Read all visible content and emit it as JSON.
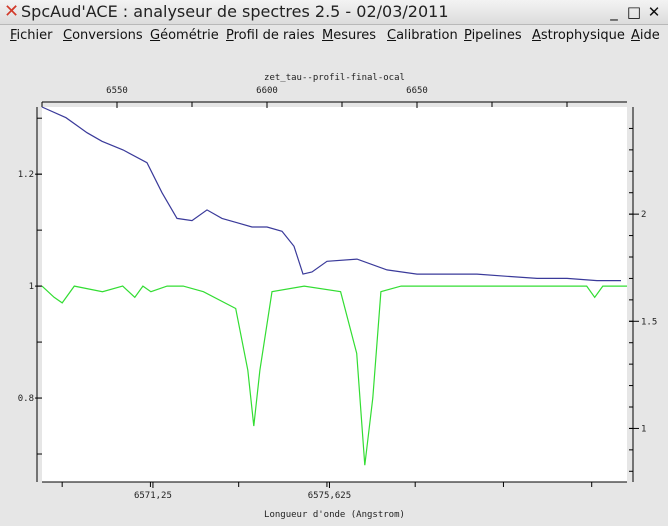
{
  "window": {
    "title": "SpcAud'ACE : analyseur de spectres 2.5 - 02/03/2011",
    "close_glyph": "✕",
    "minimize_glyph": "_",
    "maximize_glyph": "□",
    "close_btn_glyph": "✕"
  },
  "menubar": {
    "items": [
      {
        "first": "F",
        "rest": "ichier"
      },
      {
        "first": "C",
        "rest": "onversions"
      },
      {
        "first": "G",
        "rest": "éométrie"
      },
      {
        "first": "P",
        "rest": "rofil de raies"
      },
      {
        "first": "M",
        "rest": "esures"
      },
      {
        "first": "C",
        "rest": "alibration"
      },
      {
        "first": "P",
        "rest": "ipelines"
      },
      {
        "first": "A",
        "rest": "strophysique"
      },
      {
        "first": "A",
        "rest": "ide"
      }
    ]
  },
  "chart_data": {
    "type": "line",
    "title": "zet_tau--profil-final-ocal",
    "xlabel": "Longueur d'onde (Angstrom)",
    "top_axis": {
      "ticks": [
        6550,
        6600,
        6650
      ],
      "labels": [
        "6550",
        "6600",
        "6650"
      ],
      "range": [
        6525,
        6720
      ]
    },
    "bottom_axis": {
      "ticks": [
        6571.25,
        6575.625
      ],
      "labels": [
        "6571,25",
        "6575,625"
      ],
      "range": [
        6568.5,
        6583
      ]
    },
    "left_axis": {
      "ticks": [
        1.2,
        1,
        0.8
      ],
      "labels": [
        "1.2",
        "1",
        "0.8"
      ],
      "range": [
        0.65,
        1.32
      ]
    },
    "right_axis": {
      "ticks": [
        2,
        1.5,
        1
      ],
      "labels": [
        "2",
        "1.5",
        "1"
      ],
      "range": [
        0.75,
        2.5
      ]
    },
    "series": [
      {
        "color": "#3a3a9a",
        "axes": "top-right",
        "x": [
          6525,
          6533,
          6540,
          6545,
          6552,
          6560,
          6565,
          6570,
          6575,
          6580,
          6585,
          6590,
          6595,
          6600,
          6605,
          6609,
          6612,
          6615,
          6620,
          6630,
          6640,
          6650,
          6660,
          6670,
          6680,
          6690,
          6700,
          6710,
          6718
        ],
        "y": [
          2.55,
          2.45,
          2.38,
          2.34,
          2.3,
          2.24,
          2.1,
          1.98,
          1.97,
          2.02,
          1.98,
          1.96,
          1.94,
          1.94,
          1.92,
          1.85,
          1.72,
          1.73,
          1.78,
          1.79,
          1.74,
          1.72,
          1.72,
          1.72,
          1.71,
          1.7,
          1.7,
          1.69,
          1.69
        ]
      },
      {
        "color": "#33dd33",
        "axes": "bottom-left",
        "x": [
          6568.5,
          6568.8,
          6569.0,
          6569.3,
          6570.0,
          6570.5,
          6570.8,
          6571.0,
          6571.2,
          6571.6,
          6572.0,
          6572.5,
          6573.3,
          6573.6,
          6573.75,
          6573.9,
          6574.2,
          6575.0,
          6575.9,
          6576.3,
          6576.5,
          6576.7,
          6576.9,
          6577.4,
          6578.0,
          6580.0,
          6582.0,
          6582.2,
          6582.4,
          6583.0
        ],
        "y": [
          1.0,
          0.98,
          0.97,
          1.0,
          0.99,
          1.0,
          0.98,
          1.0,
          0.99,
          1.0,
          1.0,
          0.99,
          0.96,
          0.85,
          0.75,
          0.85,
          0.99,
          1.0,
          0.99,
          0.88,
          0.68,
          0.8,
          0.99,
          1.0,
          1.0,
          1.0,
          1.0,
          0.98,
          1.0,
          1.0
        ]
      }
    ]
  }
}
